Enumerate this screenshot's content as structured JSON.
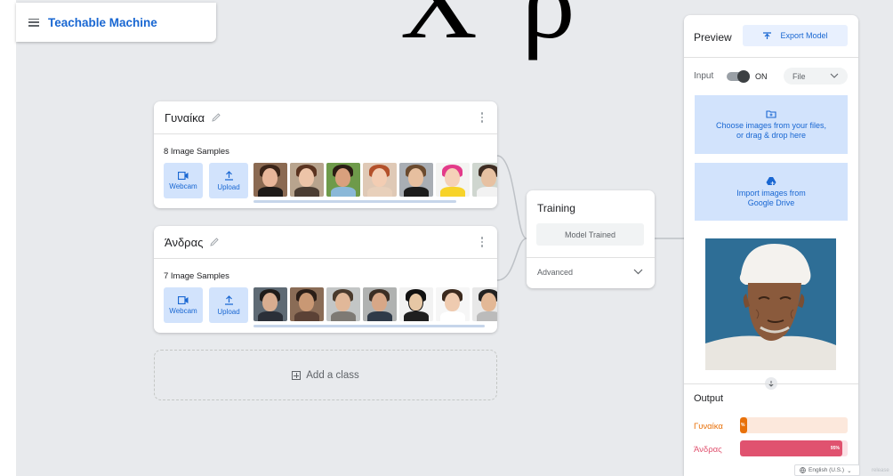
{
  "app": {
    "title": "Teachable Machine"
  },
  "overlay_text": "Χ ρ",
  "classes": [
    {
      "name": "Γυναίκα",
      "samples_label": "8 Image Samples",
      "webcam_label": "Webcam",
      "upload_label": "Upload"
    },
    {
      "name": "Άνδρας",
      "samples_label": "7 Image Samples",
      "webcam_label": "Webcam",
      "upload_label": "Upload"
    }
  ],
  "add_class_label": "Add a class",
  "training": {
    "title": "Training",
    "status_button": "Model Trained",
    "advanced_label": "Advanced"
  },
  "preview": {
    "title": "Preview",
    "export_label": "Export Model",
    "input_label": "Input",
    "toggle_state": "ON",
    "source_select": "File",
    "upload_box_line1": "Choose images from your files,",
    "upload_box_line2": "or drag & drop here",
    "drive_box_line1": "Import images from",
    "drive_box_line2": "Google Drive",
    "output_label": "Output",
    "outputs": [
      {
        "label": "Γυναίκα",
        "percent": 5,
        "percent_text": "%",
        "color": "#e8710a",
        "track": "#fce8dc"
      },
      {
        "label": "Άνδρας",
        "percent": 95,
        "percent_text": "95%",
        "color": "#e0526f",
        "track": "#fbe0e5"
      }
    ]
  },
  "footer": {
    "language": "English (U.S.)",
    "release": "release"
  },
  "colors": {
    "accent": "#1967d2",
    "canvas": "#e8eaed",
    "light_blue": "#d2e3fc"
  }
}
